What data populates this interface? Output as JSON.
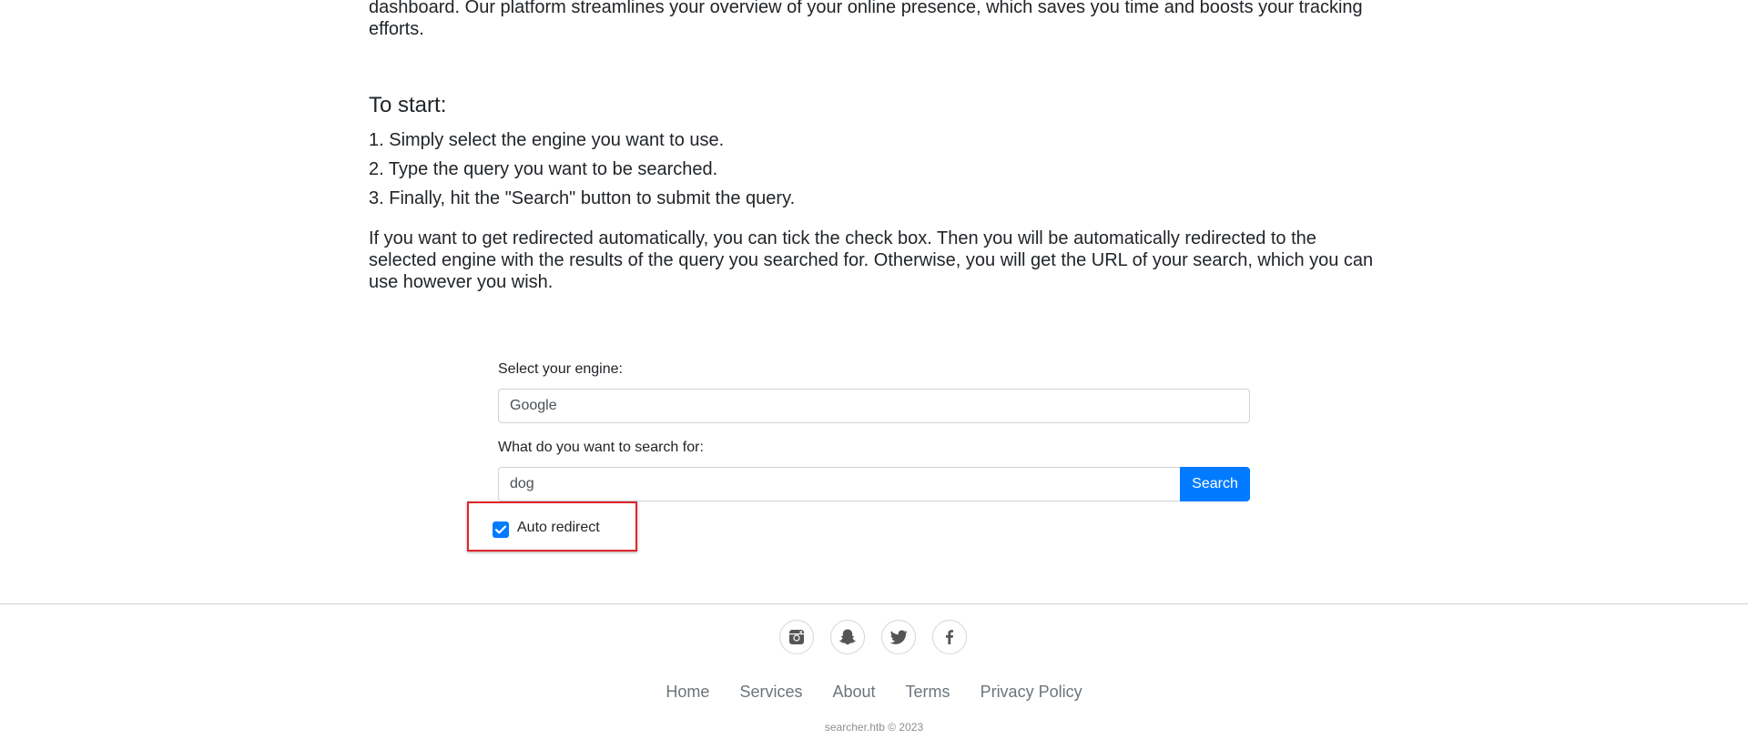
{
  "intro": {
    "tail_text": "dashboard. Our platform streamlines your overview of your online presence, which saves you time and boosts your tracking efforts."
  },
  "start": {
    "heading": "To start:",
    "steps": [
      "1. Simply select the engine you want to use.",
      "2. Type the query you want to be searched.",
      "3. Finally, hit the \"Search\" button to submit the query."
    ]
  },
  "redirect_info": "If you want to get redirected automatically, you can tick the check box. Then you will be automatically redirected to the selected engine with the results of the query you searched for. Otherwise, you will get the URL of your search, which you can use however you wish.",
  "form": {
    "engine_label": "Select your engine:",
    "engine_value": "Google",
    "query_label": "What do you want to search for:",
    "query_value": "dog",
    "search_button": "Search",
    "auto_redirect_label": "Auto redirect",
    "auto_redirect_checked": true
  },
  "footer": {
    "social_icons": [
      "instagram-icon",
      "snapchat-icon",
      "twitter-icon",
      "facebook-icon"
    ],
    "nav": [
      "Home",
      "Services",
      "About",
      "Terms",
      "Privacy Policy"
    ],
    "copyright": "searcher.htb © 2023"
  },
  "colors": {
    "accent": "#007bff",
    "highlight_box": "#e0262a",
    "text": "#212529",
    "muted": "#6c757d"
  }
}
